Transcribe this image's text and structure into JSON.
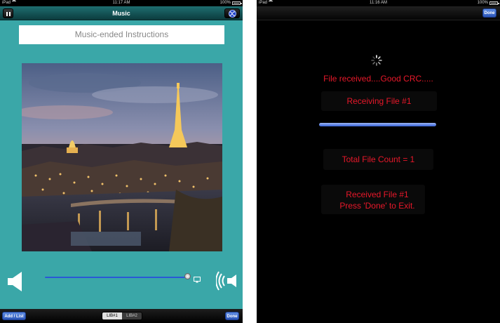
{
  "left_screen": {
    "statusbar": {
      "device": "iPad",
      "time": "11:17 AM",
      "battery": "100%"
    },
    "navbar": {
      "title": "Music"
    },
    "instructions_label": "Music-ended Instructions",
    "toolbar": {
      "add_list_label": "Add / List",
      "lib1_label": "LIB#1",
      "lib2_label": "LIB#2",
      "done_label": "Done"
    },
    "volume_level": 1.0
  },
  "right_screen": {
    "statusbar": {
      "device": "iPad",
      "time": "11:16 AM",
      "battery": "100%"
    },
    "navbar": {
      "done_label": "Done"
    },
    "file_received": "File received....Good  CRC.....",
    "receiving_file": "Receiving File #1",
    "progress": 1.0,
    "total_count": "Total File Count = 1",
    "received_line1": "Received File #1",
    "received_line2": "Press 'Done' to Exit."
  },
  "colors": {
    "left_background": "#3aa7a8",
    "right_background": "#000000",
    "message_red": "#e8182a",
    "button_blue": "#2b55b8"
  }
}
